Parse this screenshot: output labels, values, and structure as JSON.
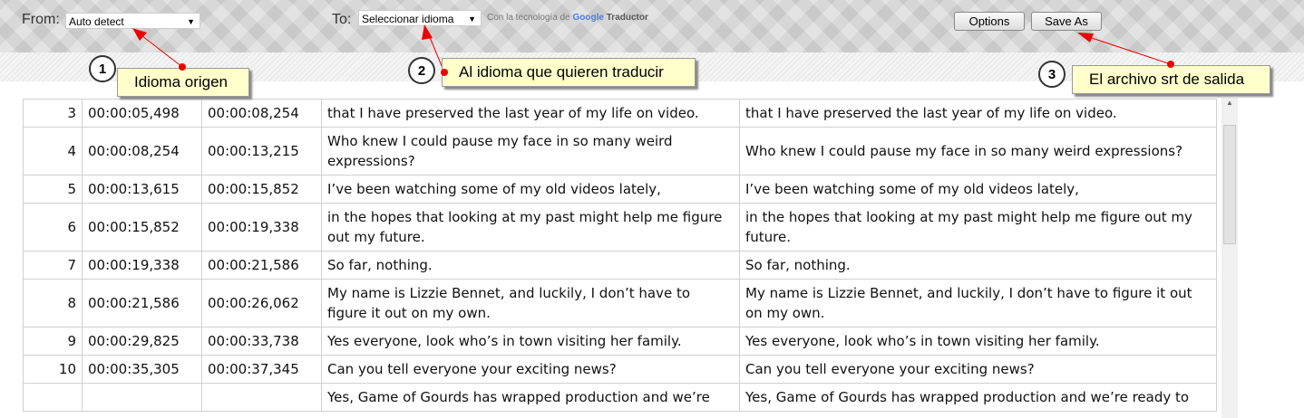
{
  "toolbar": {
    "from_label": "From:",
    "from_value": "Auto detect",
    "to_label": "To:",
    "to_value": "Seleccionar idioma",
    "powered_by": "Con la tecnología de",
    "google": "Google",
    "translate": "Traductor",
    "options_label": "Options",
    "save_as_label": "Save As"
  },
  "annotations": [
    {
      "number": "1",
      "text": "Idioma origen"
    },
    {
      "number": "2",
      "text": "Al idioma que quieren traducir"
    },
    {
      "number": "3",
      "text": "El archivo srt de salida"
    }
  ],
  "annotation_color": "#e00000",
  "rows": [
    {
      "n": "3",
      "start": "00:00:05,498",
      "end": "00:00:08,254",
      "text": "that I have preserved the last year of my life on video.",
      "translation": "that I have preserved the last year of my life on video."
    },
    {
      "n": "4",
      "start": "00:00:08,254",
      "end": "00:00:13,215",
      "text": "Who knew I could pause my face in so many weird expressions?",
      "translation": "Who knew I could pause my face in so many weird expressions?"
    },
    {
      "n": "5",
      "start": "00:00:13,615",
      "end": "00:00:15,852",
      "text": "I’ve been watching some of my old videos lately,",
      "translation": "I’ve been watching some of my old videos lately,"
    },
    {
      "n": "6",
      "start": "00:00:15,852",
      "end": "00:00:19,338",
      "text": "in the hopes that looking at my past might help me figure out my future.",
      "translation": "in the hopes that looking at my past might help me figure out my future."
    },
    {
      "n": "7",
      "start": "00:00:19,338",
      "end": "00:00:21,586",
      "text": "So far, nothing.",
      "translation": "So far, nothing."
    },
    {
      "n": "8",
      "start": "00:00:21,586",
      "end": "00:00:26,062",
      "text": "My name is Lizzie Bennet, and luckily, I don’t have to figure it out on my own.",
      "translation": "My name is Lizzie Bennet, and luckily, I don’t have to figure it out on my own."
    },
    {
      "n": "9",
      "start": "00:00:29,825",
      "end": "00:00:33,738",
      "text": "Yes everyone, look who’s in town visiting her family.",
      "translation": "Yes everyone, look who’s in town visiting her family."
    },
    {
      "n": "10",
      "start": "00:00:35,305",
      "end": "00:00:37,345",
      "text": "Can you tell everyone your exciting news?",
      "translation": "Can you tell everyone your exciting news?"
    },
    {
      "n": "",
      "start": "",
      "end": "",
      "text": "Yes, Game of Gourds has wrapped production and we’re",
      "translation": "Yes, Game of Gourds has wrapped production and we’re ready to"
    }
  ]
}
